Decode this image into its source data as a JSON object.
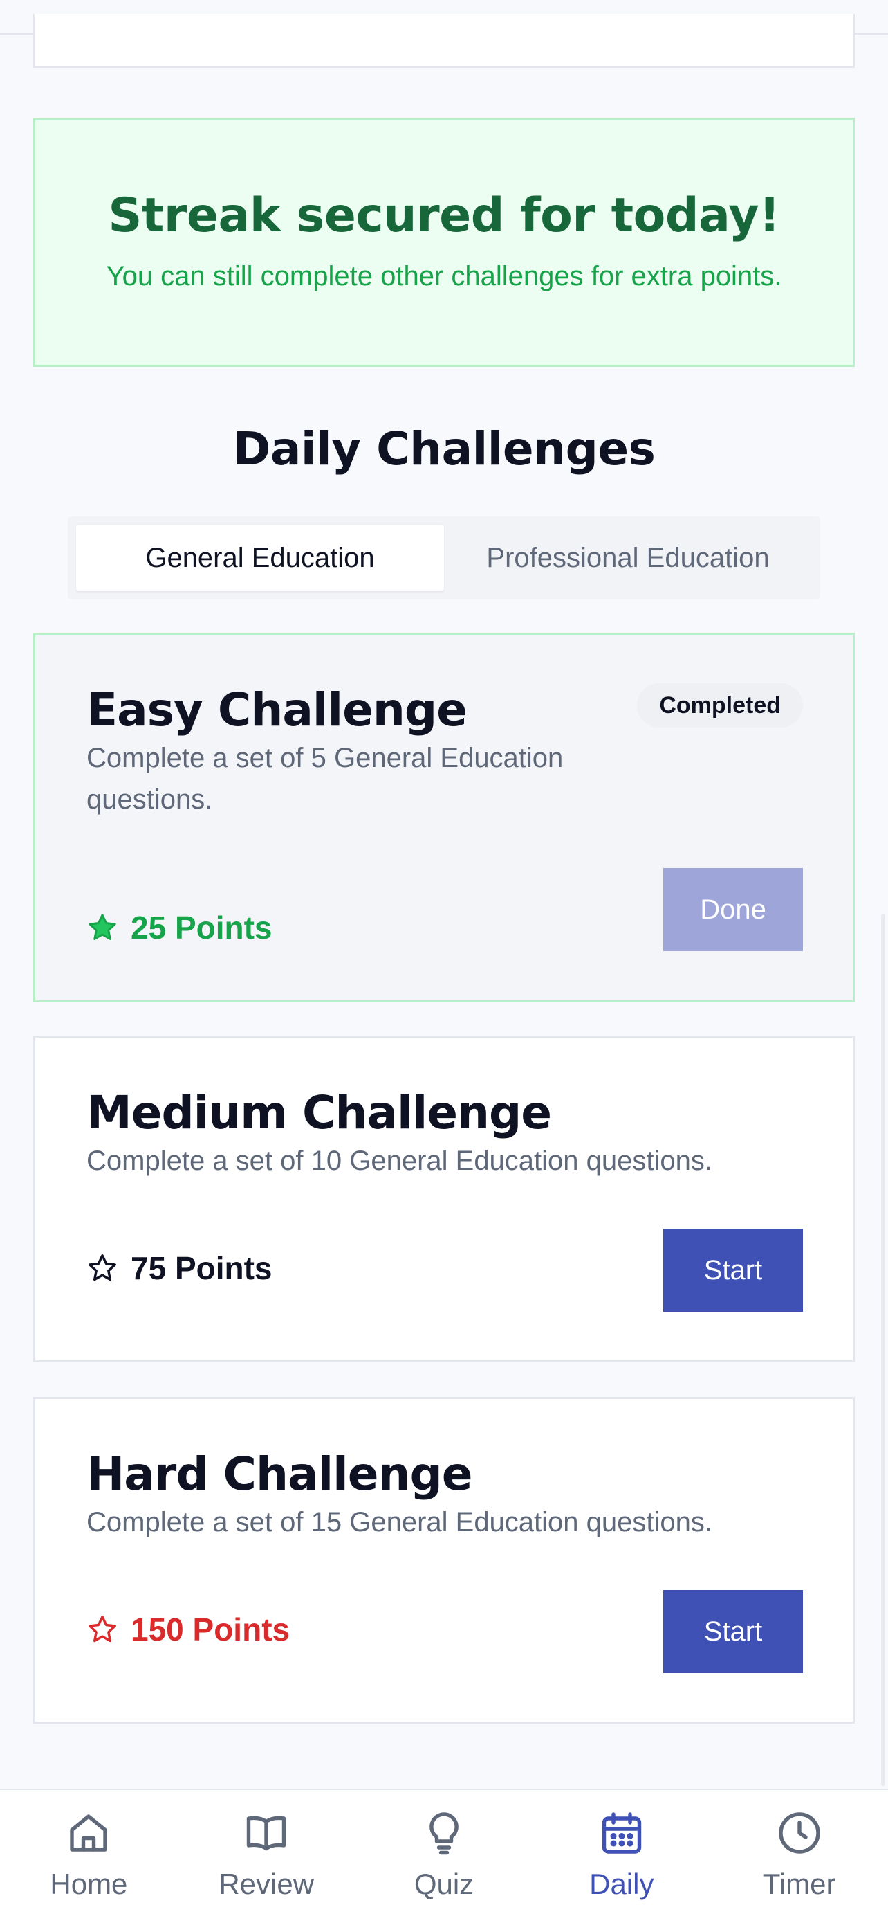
{
  "streak": {
    "title": "Streak secured for today!",
    "subtitle": "You can still complete other challenges for extra points."
  },
  "section_title": "Daily Challenges",
  "tabs": [
    {
      "label": "General Education",
      "active": true
    },
    {
      "label": "Professional Education",
      "active": false
    }
  ],
  "challenges": [
    {
      "title": "Easy Challenge",
      "description": "Complete a set of 5 General Education questions.",
      "points": "25 Points",
      "points_color": "#17a34a",
      "star": "filled-star-icon",
      "badge": "Completed",
      "button": "Done",
      "status": "completed"
    },
    {
      "title": "Medium Challenge",
      "description": "Complete a set of 10 General Education questions.",
      "points": "75 Points",
      "points_color": "#0f1222",
      "star": "star-outline-icon",
      "button": "Start",
      "status": "available"
    },
    {
      "title": "Hard Challenge",
      "description": "Complete a set of 15 General Education questions.",
      "points": "150 Points",
      "points_color": "#d92b2b",
      "star": "star-outline-icon",
      "button": "Start",
      "status": "available"
    }
  ],
  "nav": [
    {
      "label": "Home",
      "icon": "home-icon"
    },
    {
      "label": "Review",
      "icon": "book-icon"
    },
    {
      "label": "Quiz",
      "icon": "lightbulb-icon"
    },
    {
      "label": "Daily",
      "icon": "calendar-icon",
      "active": true
    },
    {
      "label": "Timer",
      "icon": "clock-icon"
    }
  ],
  "colors": {
    "primary": "#3f51b5",
    "success": "#17a34a",
    "danger": "#d92b2b"
  }
}
